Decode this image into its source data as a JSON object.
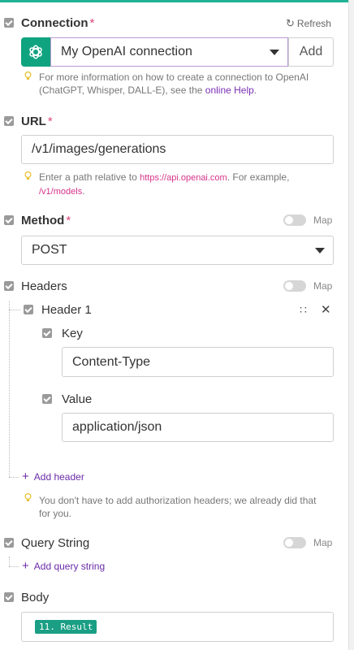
{
  "connection": {
    "label": "Connection",
    "required_mark": "*",
    "refresh_label": "Refresh",
    "value": "My OpenAI connection",
    "add_label": "Add",
    "hint_prefix": "For more information on how to create a connection to OpenAI (ChatGPT, Whisper, DALL-E), see the",
    "hint_link": "online Help",
    "hint_suffix": "."
  },
  "url": {
    "label": "URL",
    "required_mark": "*",
    "value": "/v1/images/generations",
    "hint_prefix": "Enter a path relative to",
    "hint_link": "https://api.openai.com",
    "hint_mid": ". For example,",
    "hint_example": "/v1/models",
    "hint_suffix": "."
  },
  "method": {
    "label": "Method",
    "required_mark": "*",
    "map_label": "Map",
    "value": "POST"
  },
  "headers": {
    "label": "Headers",
    "map_label": "Map",
    "item_label": "Header 1",
    "key_label": "Key",
    "key_value": "Content-Type",
    "value_label": "Value",
    "value_value": "application/json",
    "add_label": "Add header",
    "hint": "You don't have to add authorization headers; we already did that for you."
  },
  "query_string": {
    "label": "Query String",
    "map_label": "Map",
    "add_label": "Add query string"
  },
  "body": {
    "label": "Body",
    "tag": "11. Result"
  },
  "colors": {
    "accent": "#1fb394",
    "openai_tile": "#10a37f",
    "link": "#7b2fb5",
    "required": "#e0457b"
  },
  "icons": [
    "openai-logo-icon",
    "refresh-icon",
    "dropdown-caret-icon",
    "lightbulb-icon",
    "drag-handle-icon",
    "close-icon",
    "plus-icon",
    "checkbox-icon"
  ]
}
